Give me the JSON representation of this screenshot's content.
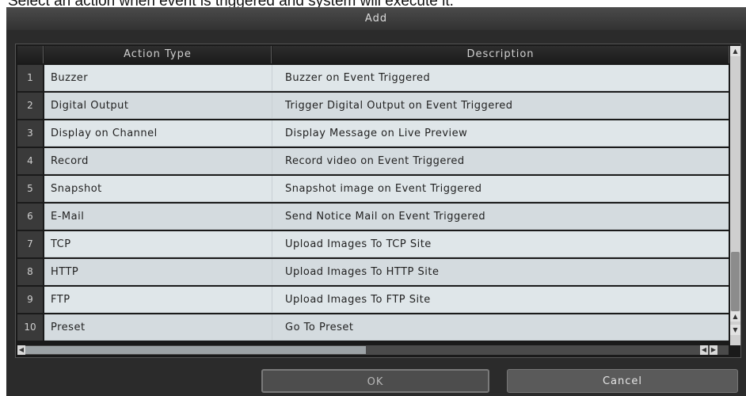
{
  "instruction": "Select an action when event is triggered and system will execute it.",
  "dialog": {
    "title": "Add",
    "table": {
      "columns": {
        "number": "",
        "type": "Action Type",
        "description": "Description"
      },
      "rows": [
        {
          "num": "1",
          "type": "Buzzer",
          "desc": "Buzzer on Event Triggered"
        },
        {
          "num": "2",
          "type": "Digital Output",
          "desc": "Trigger Digital Output on Event Triggered"
        },
        {
          "num": "3",
          "type": "Display on Channel",
          "desc": "Display Message on Live Preview"
        },
        {
          "num": "4",
          "type": "Record",
          "desc": "Record video on Event Triggered"
        },
        {
          "num": "5",
          "type": "Snapshot",
          "desc": "Snapshot image on Event Triggered"
        },
        {
          "num": "6",
          "type": "E-Mail",
          "desc": "Send Notice Mail on Event Triggered"
        },
        {
          "num": "7",
          "type": "TCP",
          "desc": "Upload Images To TCP Site"
        },
        {
          "num": "8",
          "type": "HTTP",
          "desc": "Upload Images To HTTP Site"
        },
        {
          "num": "9",
          "type": "FTP",
          "desc": "Upload Images To FTP Site"
        },
        {
          "num": "10",
          "type": "Preset",
          "desc": "Go To Preset"
        }
      ]
    },
    "buttons": {
      "ok": "OK",
      "cancel": "Cancel"
    },
    "scroll": {
      "up": "▲",
      "down": "▼",
      "left": "◀",
      "right": "▶"
    }
  }
}
